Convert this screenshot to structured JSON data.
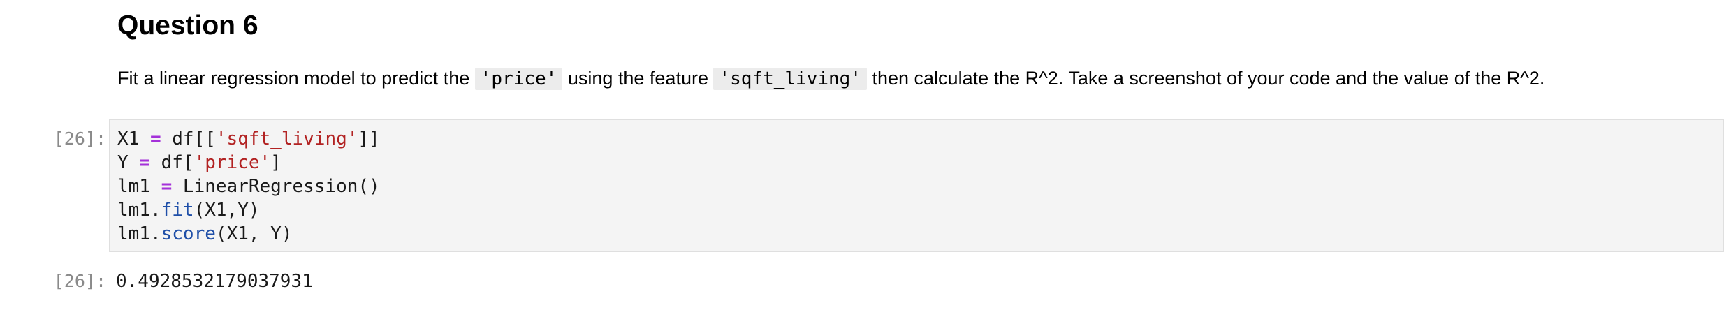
{
  "markdown": {
    "heading": "Question 6",
    "para": {
      "t1": "Fit a linear regression model to predict the ",
      "code1": "'price'",
      "t2": " using the feature ",
      "code2": "'sqft_living'",
      "t3": " then calculate the R^2. Take a screenshot of your code and the value of the R^2."
    }
  },
  "code_cell": {
    "prompt": "[26]:",
    "lines": {
      "l1": {
        "a": "X1 ",
        "op": "=",
        "b": " df[[",
        "str": "'sqft_living'",
        "c": "]]"
      },
      "l2": {
        "a": "Y ",
        "op": "=",
        "b": " df[",
        "str": "'price'",
        "c": "]"
      },
      "l3": {
        "a": "lm1 ",
        "op": "=",
        "b": " LinearRegression()"
      },
      "l4": {
        "a": "lm1.",
        "attr": "fit",
        "b": "(X1,Y)"
      },
      "l5": {
        "a": "lm1.",
        "attr": "score",
        "b": "(X1, Y)"
      }
    }
  },
  "output_cell": {
    "prompt": "[26]:",
    "value": "0.4928532179037931"
  }
}
